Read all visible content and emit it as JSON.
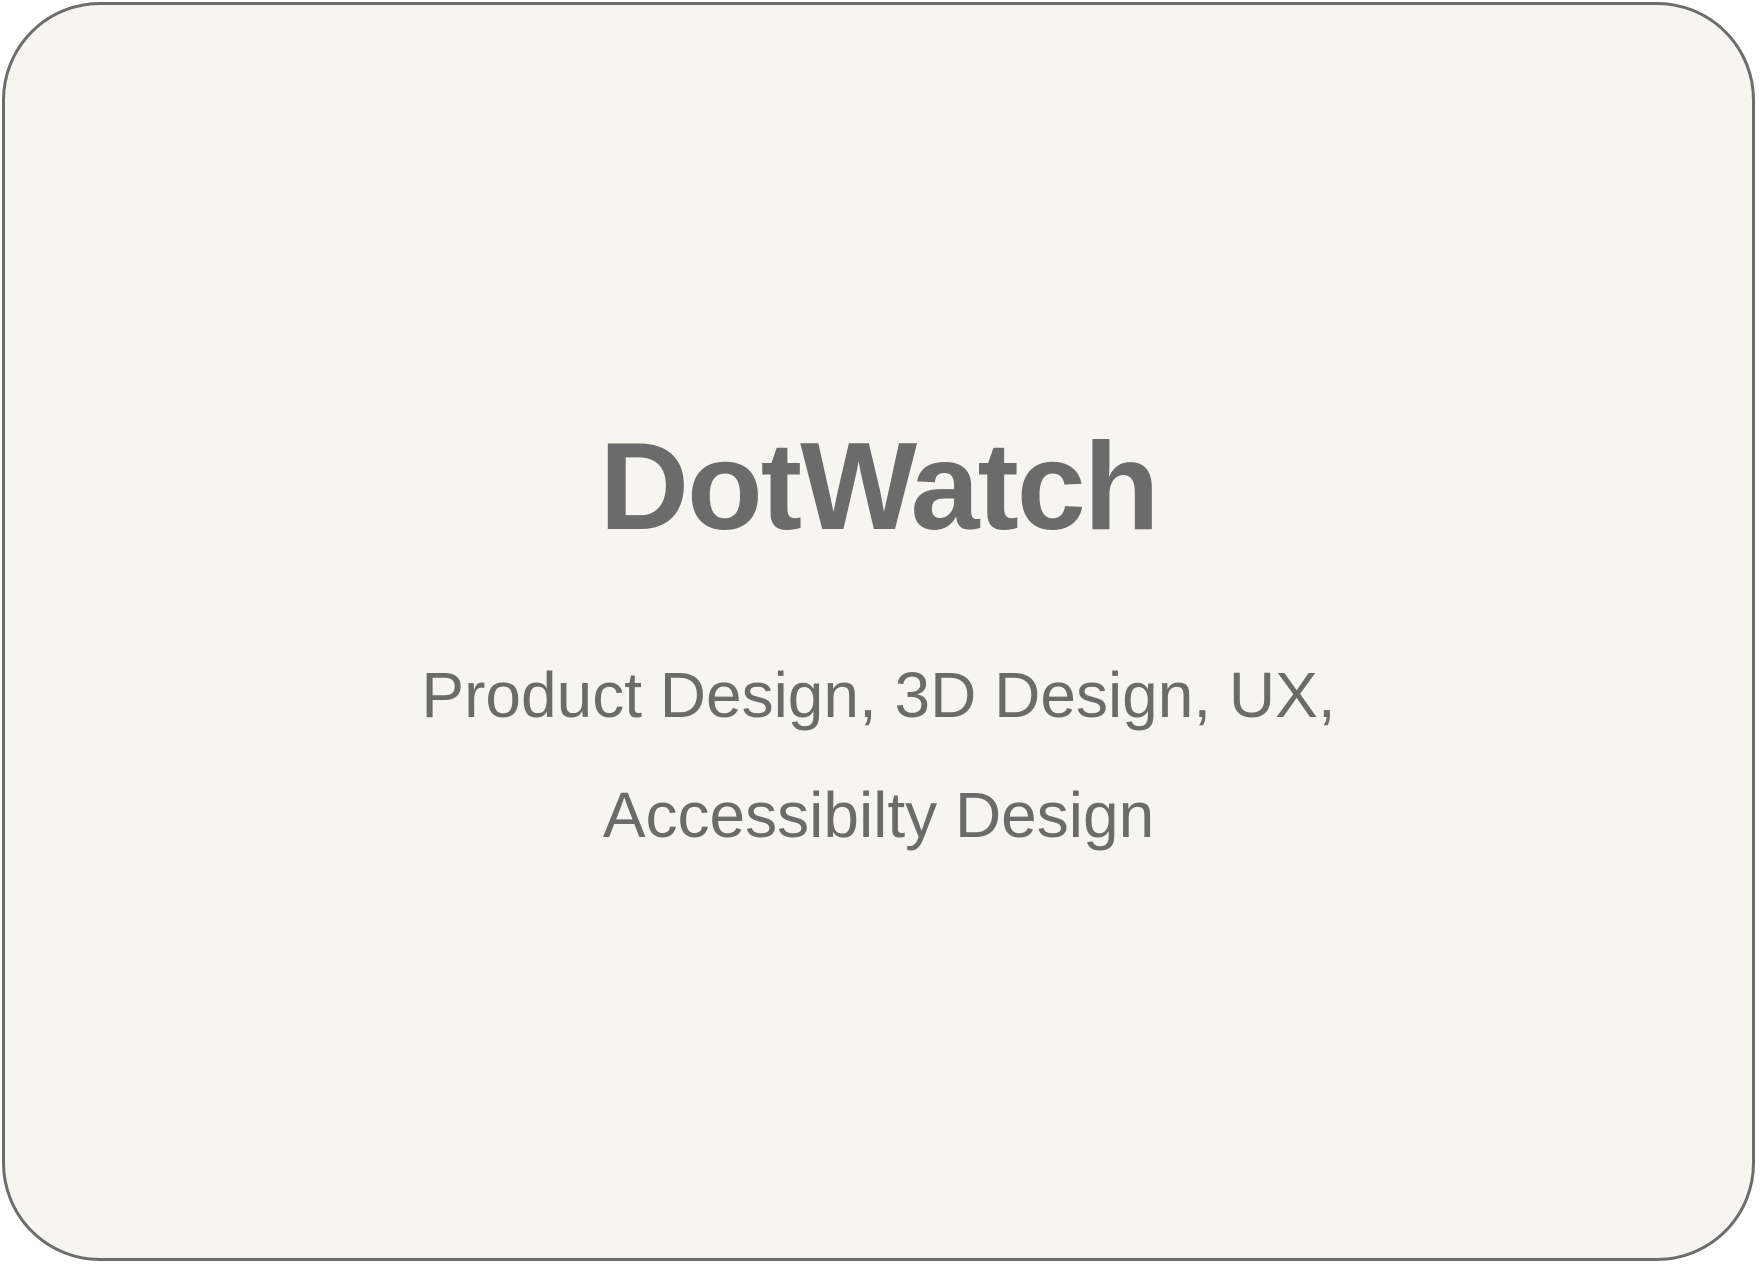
{
  "card": {
    "title": "DotWatch",
    "subtitle_lines": [
      "Product Design, 3D Design, UX,",
      "Accessibilty Design"
    ]
  },
  "colors": {
    "card_background": "#f6f5f1",
    "card_border": "#6d6d6d",
    "text": "#6b6b6b"
  }
}
